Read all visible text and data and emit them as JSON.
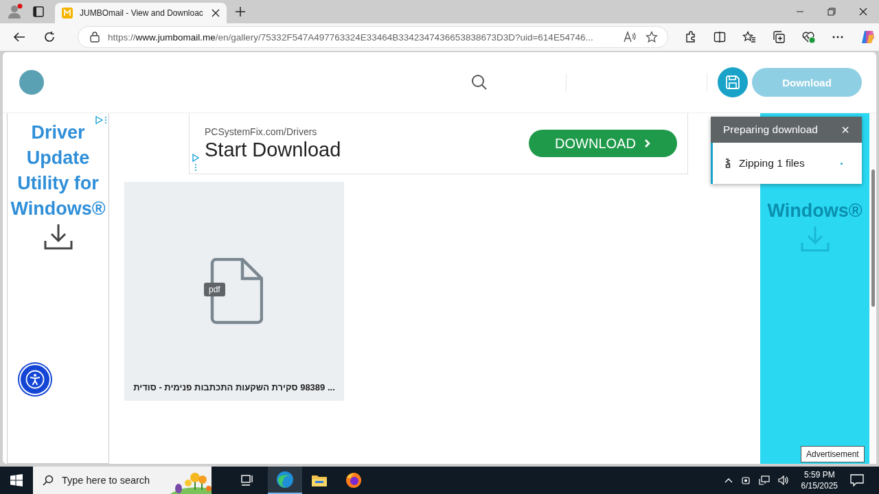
{
  "browser": {
    "tab_title": "JUMBOmail - View and Downloac",
    "url_scheme": "https://",
    "url_host": "www.jumbomail.me",
    "url_path": "/en/gallery/75332F547A497763324E33464B3342347436653838673D3D?uid=614E54746..."
  },
  "header": {
    "download_button": {
      "label": "Download",
      "disabled": true
    }
  },
  "left_ad": {
    "text": "Driver Update Utility for Windows®"
  },
  "banner_ad": {
    "domain": "PCSystemFix.com/Drivers",
    "headline": "Start Download",
    "button": "DOWNLOAD"
  },
  "file_card": {
    "badge": "pdf",
    "name": "... 98389 סקירת השקעות התכתבות פנימית - סודית"
  },
  "right_ad": {
    "lines": [
      "Windows®"
    ]
  },
  "download_popup": {
    "title": "Preparing download",
    "close": "×",
    "status": "Zipping 1 files"
  },
  "ad_label": "Advertisement",
  "taskbar": {
    "search_placeholder": "Type here to search",
    "time": "5:59 PM",
    "date": "6/15/2025"
  }
}
